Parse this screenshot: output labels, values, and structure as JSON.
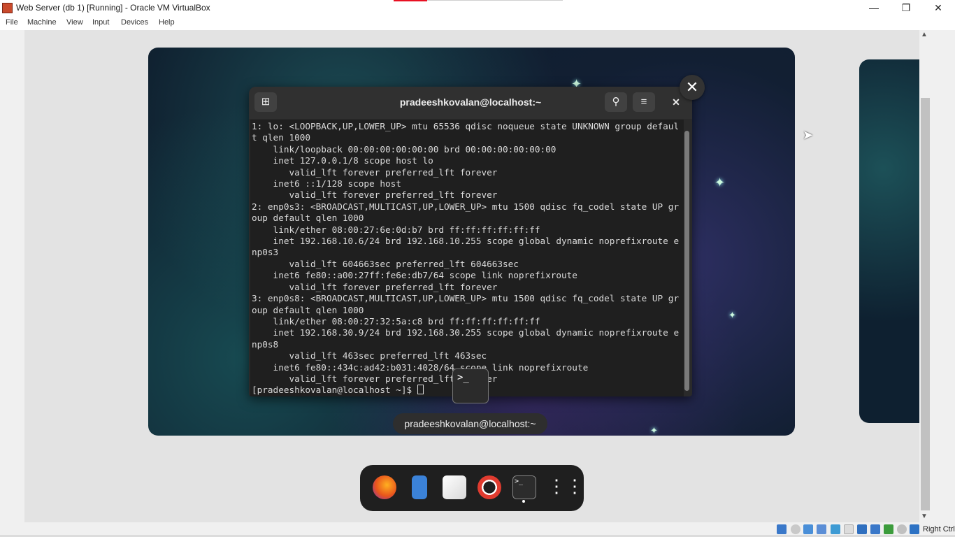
{
  "window": {
    "title": "Web Server (db 1) [Running] - Oracle VM VirtualBox",
    "controls": [
      "minimize-icon",
      "restore-icon",
      "close-icon"
    ]
  },
  "menu": [
    "File",
    "Machine",
    "View",
    "Input",
    "Devices",
    "Help"
  ],
  "terminal": {
    "title": "pradeeshkovalan@localhost:~",
    "lines": [
      "1: lo: <LOOPBACK,UP,LOWER_UP> mtu 65536 qdisc noqueue state UNKNOWN group defaul",
      "t qlen 1000",
      "    link/loopback 00:00:00:00:00:00 brd 00:00:00:00:00:00",
      "    inet 127.0.0.1/8 scope host lo",
      "       valid_lft forever preferred_lft forever",
      "    inet6 ::1/128 scope host",
      "       valid_lft forever preferred_lft forever",
      "2: enp0s3: <BROADCAST,MULTICAST,UP,LOWER_UP> mtu 1500 qdisc fq_codel state UP gr",
      "oup default qlen 1000",
      "    link/ether 08:00:27:6e:0d:b7 brd ff:ff:ff:ff:ff:ff",
      "    inet 192.168.10.6/24 brd 192.168.10.255 scope global dynamic noprefixroute e",
      "np0s3",
      "       valid_lft 604663sec preferred_lft 604663sec",
      "    inet6 fe80::a00:27ff:fe6e:db7/64 scope link noprefixroute",
      "       valid_lft forever preferred_lft forever",
      "3: enp0s8: <BROADCAST,MULTICAST,UP,LOWER_UP> mtu 1500 qdisc fq_codel state UP gr",
      "oup default qlen 1000",
      "    link/ether 08:00:27:32:5a:c8 brd ff:ff:ff:ff:ff:ff",
      "    inet 192.168.30.9/24 brd 192.168.30.255 scope global dynamic noprefixroute e",
      "np0s8",
      "       valid_lft 463sec preferred_lft 463sec",
      "    inet6 fe80::434c:ad42:b031:4028/64 scope link noprefixroute",
      "       valid_lft forever preferred_lft forever"
    ],
    "prompt": "[pradeeshkovalan@localhost ~]$ "
  },
  "overview": {
    "window_label": "pradeeshkovalan@localhost:~",
    "thumb_text": ">_"
  },
  "dash": {
    "apps": [
      "firefox-icon",
      "files-icon",
      "software-icon",
      "help-icon",
      "terminal-icon",
      "app-grid-icon"
    ]
  },
  "statusbar": {
    "host_key": "Right Ctrl"
  }
}
